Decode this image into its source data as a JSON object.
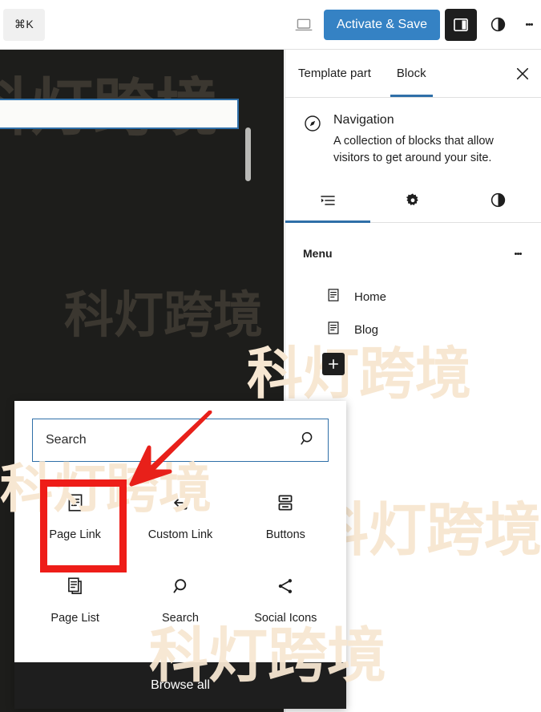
{
  "topbar": {
    "command_shortcut": "⌘K",
    "device_icon": "laptop-icon",
    "activate_label": "Activate & Save",
    "sidebar_toggle_icon": "sidebar-panel-icon",
    "styles_icon": "styles-contrast-icon",
    "more_icon": "kebab-menu-icon"
  },
  "sidebar": {
    "tabs": [
      {
        "label": "Template part",
        "active": false
      },
      {
        "label": "Block",
        "active": true
      }
    ],
    "close_icon": "close-icon",
    "block": {
      "icon": "navigation-compass-icon",
      "title": "Navigation",
      "description": "A collection of blocks that allow visitors to get around your site."
    },
    "subtabs": [
      {
        "icon": "list-view-icon",
        "active": true
      },
      {
        "icon": "gear-icon",
        "active": false
      },
      {
        "icon": "styles-contrast-icon",
        "active": false
      }
    ],
    "menu": {
      "title": "Menu",
      "more_icon": "kebab-menu-icon",
      "items": [
        {
          "icon": "page-icon",
          "label": "Home"
        },
        {
          "icon": "page-icon",
          "label": "Blog"
        }
      ],
      "add_icon": "plus-icon"
    }
  },
  "inserter": {
    "search": {
      "placeholder": "Search",
      "value": "",
      "icon": "search-icon"
    },
    "blocks": [
      {
        "icon": "page-icon",
        "label": "Page Link",
        "highlighted": true
      },
      {
        "icon": "custom-link-icon",
        "label": "Custom Link",
        "highlighted": false
      },
      {
        "icon": "buttons-icon",
        "label": "Buttons",
        "highlighted": false
      },
      {
        "icon": "page-list-icon",
        "label": "Page List",
        "highlighted": false
      },
      {
        "icon": "search-icon",
        "label": "Search",
        "highlighted": false
      },
      {
        "icon": "social-icons-icon",
        "label": "Social Icons",
        "highlighted": false
      }
    ],
    "browse_all_label": "Browse all"
  },
  "annotations": {
    "highlight_color": "#ee1d18",
    "arrow_color": "#e8201a",
    "arrow_icon": "red-arrow-pointing-down-left"
  },
  "watermark": {
    "text": "科灯跨境",
    "logo": "@",
    "color_light": "#f7e7d2",
    "color_on_dark": "rgba(245,222,179,0.14)"
  },
  "colors": {
    "accent_blue": "#3582c4",
    "tab_underline": "#2f6fa8",
    "canvas_dark": "#1d1d1b",
    "chrome_dark": "#1e1e1e"
  }
}
